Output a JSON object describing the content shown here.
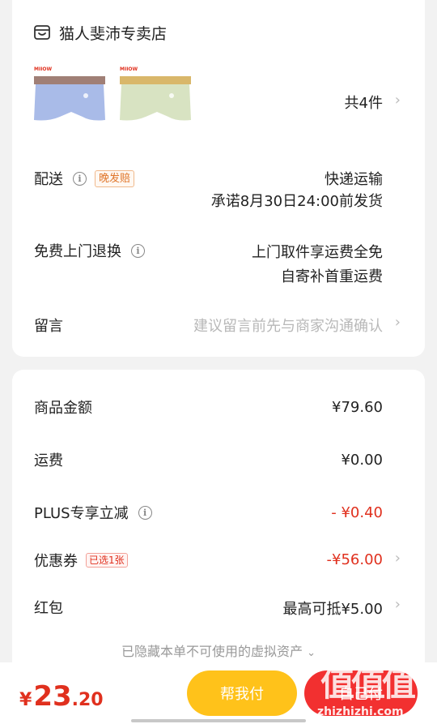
{
  "store": {
    "name": "猫人斐沛专卖店",
    "icon": "store-icon"
  },
  "products": {
    "count_label": "共4件",
    "brand_tag": "MIIOW",
    "items": [
      {
        "color": "#a9bbe8",
        "waistband": "#a07f76"
      },
      {
        "color": "#d8e3c2",
        "waistband": "#d9b76a"
      }
    ]
  },
  "delivery": {
    "label": "配送",
    "badge": "晚发赔",
    "method": "快递运输",
    "promise": "承诺8月30日24:00前发货"
  },
  "returns": {
    "label": "免费上门退换",
    "line1": "上门取件享运费全免",
    "line2": "自寄补首重运费"
  },
  "message": {
    "label": "留言",
    "placeholder": "建议留言前先与商家沟通确认"
  },
  "summary": {
    "goods_label": "商品金额",
    "goods_value": "¥79.60",
    "shipping_label": "运费",
    "shipping_value": "¥0.00",
    "plus_label": "PLUS专享立减",
    "plus_value": "- ¥0.40",
    "coupon_label": "优惠券",
    "coupon_badge": "已选1张",
    "coupon_value": "-¥56.00",
    "redpacket_label": "红包",
    "redpacket_value": "最高可抵¥5.00",
    "hidden_note": "已隐藏本单不可使用的虚拟资产"
  },
  "footer": {
    "currency": "¥",
    "total_int": "23",
    "total_dec": ".20",
    "help_pay": "帮我付",
    "self_pay": "自己付"
  },
  "watermark": {
    "logo": "值值值",
    "url": "zhizhizhi.com"
  },
  "colors": {
    "accent_red": "#e0301e",
    "help_yellow": "#ffc21a",
    "pay_red": "#f23030"
  }
}
